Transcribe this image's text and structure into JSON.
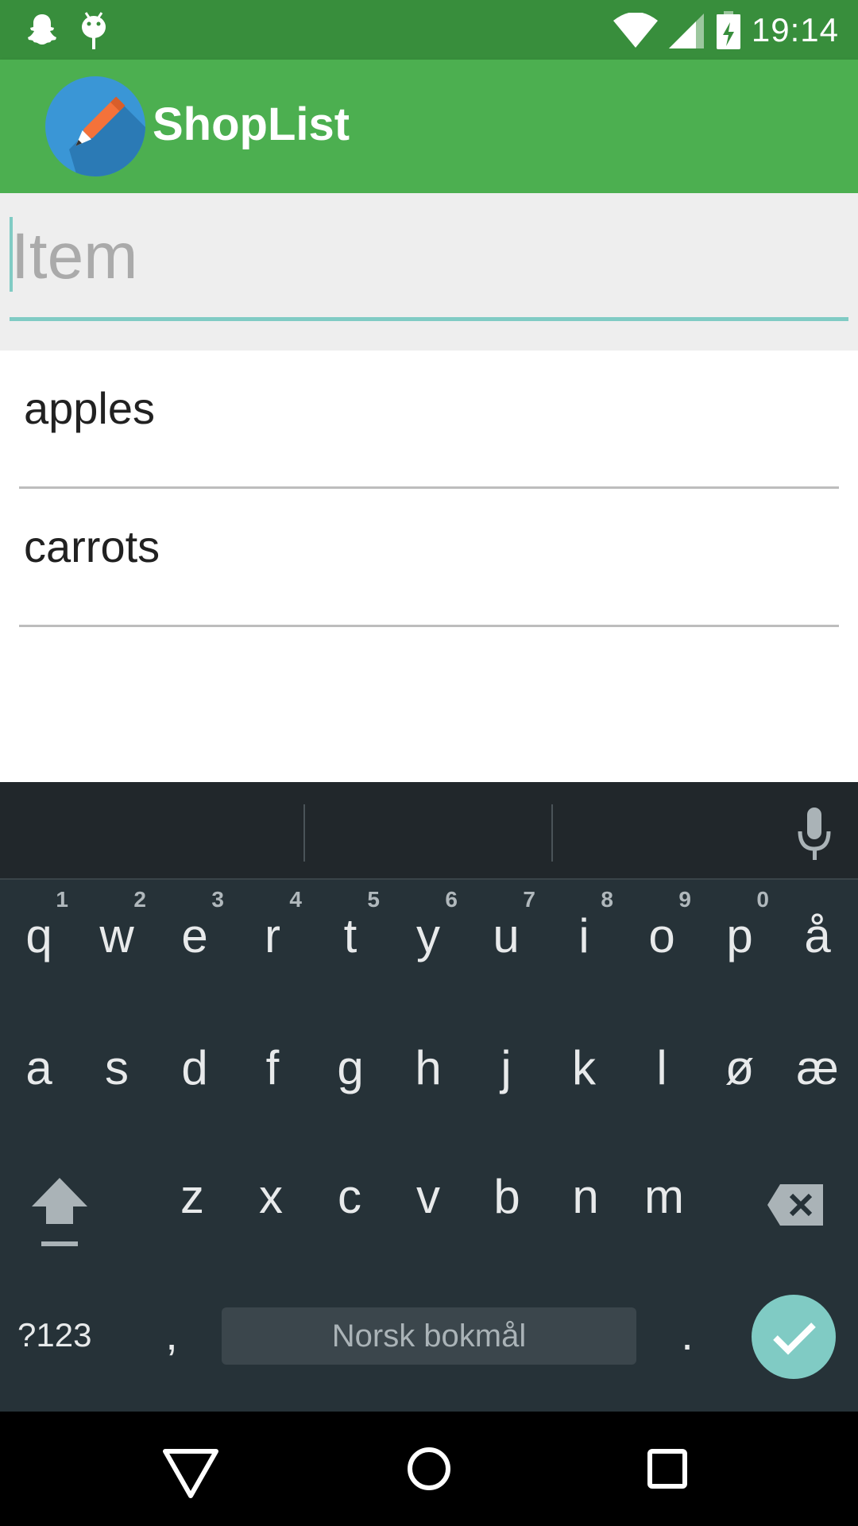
{
  "status_bar": {
    "time": "19:14",
    "icons": [
      "snapchat-icon",
      "android-debug-icon",
      "wifi-icon",
      "cell-signal-icon",
      "battery-charging-icon"
    ]
  },
  "app_bar": {
    "title": "ShopList",
    "logo_icon": "pen-logo-icon",
    "color": "#4CAF50",
    "status_color": "#388E3C"
  },
  "item_input": {
    "placeholder": "Item",
    "value": "",
    "accent_color": "#80CBC4"
  },
  "list": {
    "items": [
      {
        "label": "apples"
      },
      {
        "label": "carrots"
      }
    ]
  },
  "keyboard": {
    "row1": [
      {
        "key": "q",
        "hint": "1"
      },
      {
        "key": "w",
        "hint": "2"
      },
      {
        "key": "e",
        "hint": "3"
      },
      {
        "key": "r",
        "hint": "4"
      },
      {
        "key": "t",
        "hint": "5"
      },
      {
        "key": "y",
        "hint": "6"
      },
      {
        "key": "u",
        "hint": "7"
      },
      {
        "key": "i",
        "hint": "8"
      },
      {
        "key": "o",
        "hint": "9"
      },
      {
        "key": "p",
        "hint": "0"
      },
      {
        "key": "å",
        "hint": ""
      }
    ],
    "row2": [
      "a",
      "s",
      "d",
      "f",
      "g",
      "h",
      "j",
      "k",
      "l",
      "ø",
      "æ"
    ],
    "row3": [
      "z",
      "x",
      "c",
      "v",
      "b",
      "n",
      "m"
    ],
    "symbols_label": "?123",
    "comma": ",",
    "space_label": "Norsk bokmål",
    "period": ".",
    "icons": [
      "shift-icon",
      "backspace-icon",
      "mic-icon",
      "done-check-icon"
    ]
  },
  "nav_bar": {
    "icons": [
      "back-icon",
      "home-icon",
      "recents-icon"
    ]
  }
}
